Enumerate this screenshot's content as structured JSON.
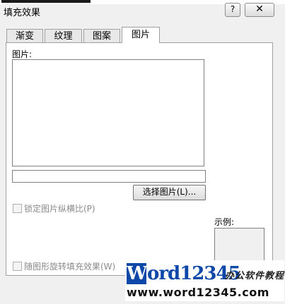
{
  "window": {
    "title": "填充效果",
    "help_label": "?",
    "close_label": "✕"
  },
  "tabs": [
    {
      "label": "渐变"
    },
    {
      "label": "纹理"
    },
    {
      "label": "图案"
    },
    {
      "label": "图片"
    }
  ],
  "picture": {
    "label": "图片:",
    "select_button": "选择图片(L)...",
    "lock_aspect_label": "锁定图片纵横比(P)",
    "rotate_fill_label": "随图形旋转填充效果(W)",
    "sample_label": "示例:"
  },
  "watermark": {
    "badge": "W",
    "brand": "ord12345",
    "cn_text": "办公软件教程",
    "url": "www.word12345.com"
  }
}
